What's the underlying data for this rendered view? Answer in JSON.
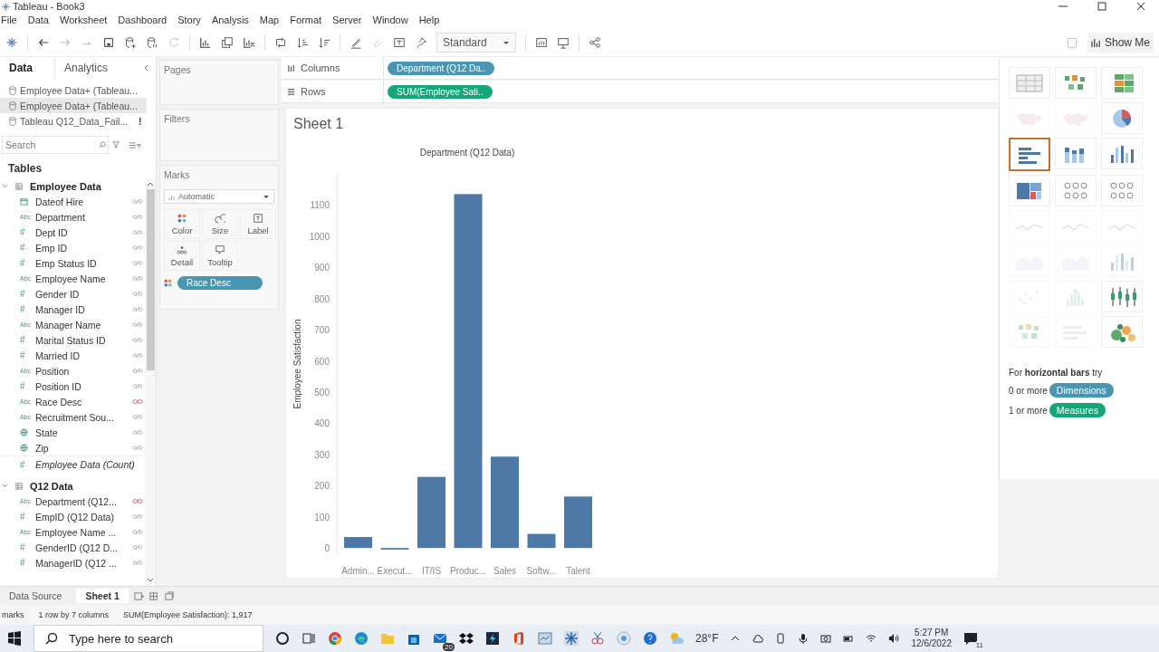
{
  "window": {
    "title": "Tableau - Book3"
  },
  "menu": [
    "File",
    "Data",
    "Worksheet",
    "Dashboard",
    "Story",
    "Analysis",
    "Map",
    "Format",
    "Server",
    "Window",
    "Help"
  ],
  "toolbar": {
    "fit": "Standard",
    "show_me": "Show Me"
  },
  "data_pane": {
    "tabs": [
      {
        "label": "Data",
        "selected": true
      },
      {
        "label": "Analytics",
        "selected": false
      }
    ],
    "sources": [
      {
        "name": "Employee Data+ (Tableau...",
        "selected": false,
        "warning": false
      },
      {
        "name": "Employee Data+ (Tableau...",
        "selected": true,
        "warning": false
      },
      {
        "name": "Tableau Q12_Data_Fail...",
        "selected": false,
        "warning": true,
        "mark": "!"
      }
    ],
    "search": {
      "placeholder": "Search"
    },
    "tables_heading": "Tables",
    "tables": [
      {
        "name": "Employee Data",
        "fields": [
          {
            "name": "Dateof Hire",
            "kind": "date",
            "linked": false
          },
          {
            "name": "Department",
            "kind": "string",
            "glyph": "Abc",
            "linked": false
          },
          {
            "name": "Dept ID",
            "kind": "number",
            "glyph": "#",
            "linked": false
          },
          {
            "name": "Emp ID",
            "kind": "number",
            "glyph": "#",
            "linked": false
          },
          {
            "name": "Emp Status ID",
            "kind": "number",
            "glyph": "#",
            "linked": false
          },
          {
            "name": "Employee Name",
            "kind": "string",
            "glyph": "Abc",
            "linked": false
          },
          {
            "name": "Gender ID",
            "kind": "number",
            "glyph": "#",
            "linked": false
          },
          {
            "name": "Manager ID",
            "kind": "number",
            "glyph": "#",
            "linked": false
          },
          {
            "name": "Manager Name",
            "kind": "string",
            "glyph": "Abc",
            "linked": false
          },
          {
            "name": "Marital Status ID",
            "kind": "number",
            "glyph": "#",
            "linked": false
          },
          {
            "name": "Married ID",
            "kind": "number",
            "glyph": "#",
            "linked": false
          },
          {
            "name": "Position",
            "kind": "string",
            "glyph": "Abc",
            "linked": false
          },
          {
            "name": "Position ID",
            "kind": "number",
            "glyph": "#",
            "linked": false
          },
          {
            "name": "Race Desc",
            "kind": "string",
            "glyph": "Abc",
            "linked": true
          },
          {
            "name": "Recruitment Sou...",
            "kind": "string",
            "glyph": "Abc",
            "linked": false
          },
          {
            "name": "State",
            "kind": "geo",
            "linked": false
          },
          {
            "name": "Zip",
            "kind": "geo",
            "linked": false
          }
        ],
        "count": {
          "name": "Employee Data (Count)",
          "glyph": "#"
        }
      },
      {
        "name": "Q12 Data",
        "fields": [
          {
            "name": "Department (Q12...",
            "kind": "string",
            "glyph": "Abc",
            "linked": true
          },
          {
            "name": "EmpID (Q12 Data)",
            "kind": "number",
            "glyph": "#",
            "linked": false
          },
          {
            "name": "Employee Name ...",
            "kind": "string",
            "glyph": "Abc",
            "linked": false
          },
          {
            "name": "GenderID (Q12 D...",
            "kind": "number",
            "glyph": "#",
            "linked": false
          },
          {
            "name": "ManagerID (Q12 ...",
            "kind": "number",
            "glyph": "#",
            "linked": false
          }
        ]
      }
    ]
  },
  "shelves": {
    "pages": "Pages",
    "filters": "Filters",
    "marks": {
      "label": "Marks",
      "type": "Automatic",
      "cards": [
        {
          "label": "Color",
          "kind": "color"
        },
        {
          "label": "Size",
          "kind": "size"
        },
        {
          "label": "Label",
          "kind": "label"
        },
        {
          "label": "Detail",
          "kind": "detail"
        },
        {
          "label": "Tooltip",
          "kind": "tooltip"
        }
      ],
      "pills": [
        {
          "label": "Race Desc",
          "kind": "color"
        }
      ]
    }
  },
  "columns": {
    "label": "Columns",
    "pill": "Department (Q12 Da..",
    "color": "#4996b2"
  },
  "rows": {
    "label": "Rows",
    "pill": "SUM(Employee Sati..",
    "color": "#16a57a"
  },
  "sheet": {
    "title": "Sheet 1",
    "chart_data": {
      "type": "bar",
      "title": "Department (Q12 Data)",
      "ylabel": "Employee Satisfaction",
      "categories": [
        "Admin...",
        "Execut...",
        "IT/IS",
        "Produc...",
        "Sales",
        "Softw...",
        "Talent"
      ],
      "values": [
        35,
        -5,
        228,
        1135,
        293,
        45,
        165
      ],
      "ylim": [
        -20,
        1200
      ],
      "yticks": [
        0,
        100,
        200,
        300,
        400,
        500,
        600,
        700,
        800,
        900,
        1000,
        1100
      ]
    }
  },
  "show_me": {
    "thumbs": [
      {
        "kind": "table",
        "enabled": true,
        "selected": false
      },
      {
        "kind": "heat",
        "enabled": true,
        "selected": false
      },
      {
        "kind": "highlight",
        "enabled": true,
        "selected": false
      },
      {
        "kind": "map",
        "enabled": false,
        "selected": false
      },
      {
        "kind": "map",
        "enabled": false,
        "selected": false
      },
      {
        "kind": "pie",
        "enabled": true,
        "selected": false
      },
      {
        "kind": "hbar",
        "enabled": true,
        "selected": true
      },
      {
        "kind": "stack",
        "enabled": true,
        "selected": false
      },
      {
        "kind": "vbar",
        "enabled": true,
        "selected": false
      },
      {
        "kind": "treemap",
        "enabled": true,
        "selected": false
      },
      {
        "kind": "circles",
        "enabled": true,
        "selected": false
      },
      {
        "kind": "circles",
        "enabled": true,
        "selected": false
      },
      {
        "kind": "line",
        "enabled": false,
        "selected": false
      },
      {
        "kind": "line",
        "enabled": false,
        "selected": false
      },
      {
        "kind": "line",
        "enabled": false,
        "selected": false
      },
      {
        "kind": "area",
        "enabled": false,
        "selected": false
      },
      {
        "kind": "area",
        "enabled": false,
        "selected": false
      },
      {
        "kind": "vbar",
        "enabled": false,
        "selected": false
      },
      {
        "kind": "scatter",
        "enabled": false,
        "selected": false
      },
      {
        "kind": "hist",
        "enabled": false,
        "selected": false
      },
      {
        "kind": "box",
        "enabled": true,
        "selected": false
      },
      {
        "kind": "heat",
        "enabled": false,
        "selected": false
      },
      {
        "kind": "bullet",
        "enabled": false,
        "selected": false
      },
      {
        "kind": "bubbles",
        "enabled": true,
        "selected": false
      }
    ],
    "hint": "For **horizontal bars** try",
    "requirements": [
      {
        "text": "0 or more",
        "pill": "Dimensions",
        "color": "#4996b2"
      },
      {
        "text": "1 or more",
        "pill": "Measures",
        "color": "#16a57a"
      }
    ]
  },
  "sheet_tabs": [
    {
      "label": "Data Source",
      "selected": false
    },
    {
      "label": "Sheet 1",
      "selected": true
    }
  ],
  "status": [
    "marks",
    "1 row by 7 columns",
    "SUM(Employee Satisfaction): 1,917"
  ],
  "taskbar": {
    "search": {
      "placeholder": "Type here to search"
    },
    "mail_badge": "20",
    "weather": "28°F",
    "time": "5:27 PM",
    "date": "12/6/2022",
    "notifications": "11"
  }
}
